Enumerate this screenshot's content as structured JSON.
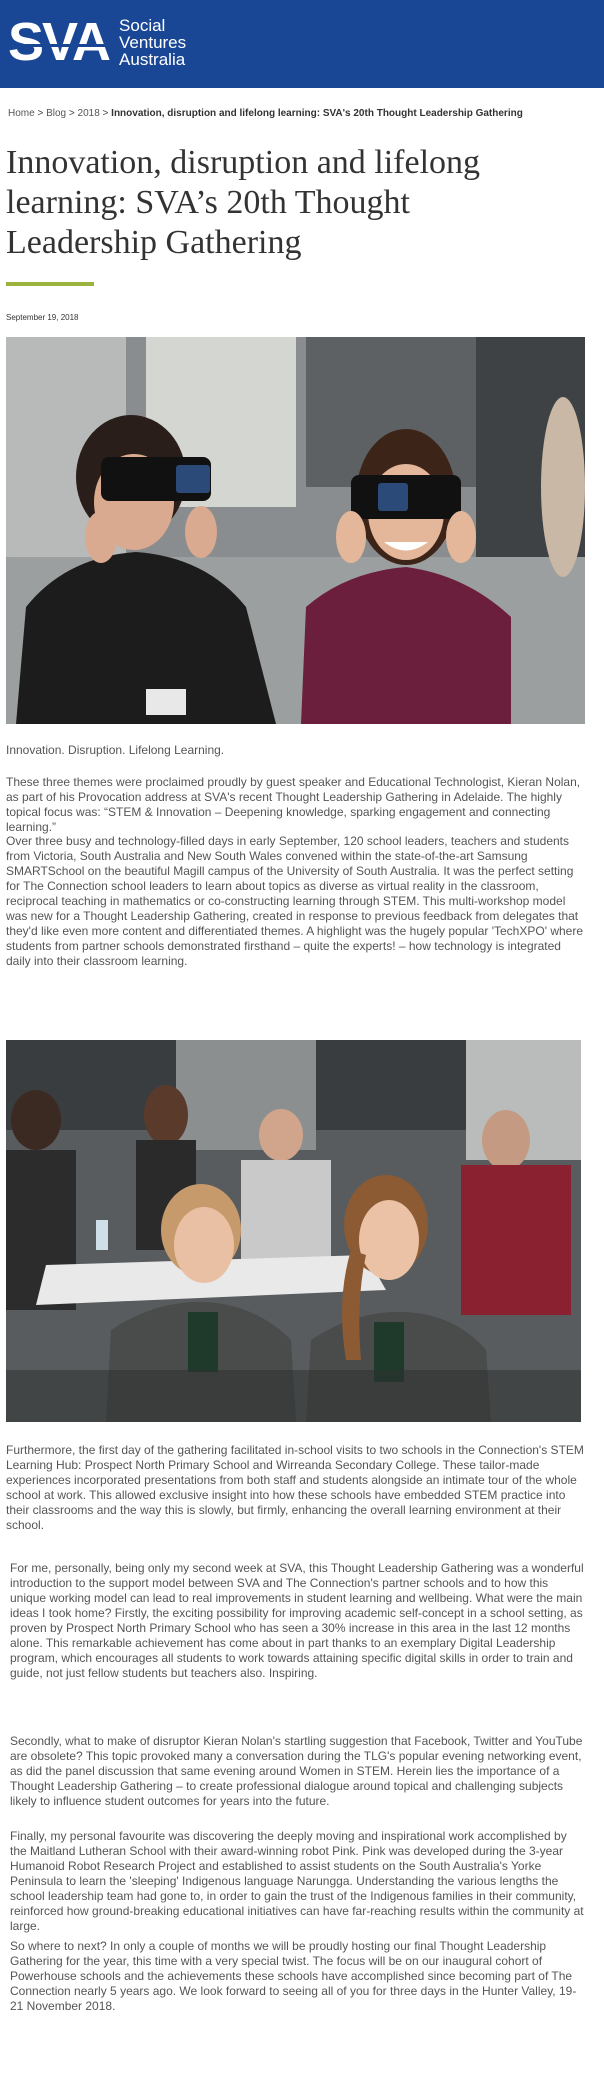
{
  "header": {
    "logo_mark": "SVA",
    "logo_lines": [
      "Social",
      "Ventures",
      "Australia"
    ],
    "background": "#1a4795"
  },
  "breadcrumb": {
    "items": [
      "Home",
      "Blog",
      "2018"
    ],
    "separator": ">",
    "current": "Innovation, disruption and lifelong learning: SVA's 20th Thought Leadership Gathering"
  },
  "article": {
    "title": "Innovation, disruption and lifelong learning: SVA’s 20th Thought Leadership Gathering",
    "accent_color": "#9cb43d",
    "date": "September 19, 2018",
    "intro": "Innovation. Disruption.  Lifelong Learning.",
    "paragraphs": [
      "These three themes were proclaimed proudly by guest speaker and Educational Technologist, Kieran Nolan, as part of his Provocation address at SVA's recent Thought Leadership Gathering in Adelaide. The highly topical focus was: “STEM & Innovation – Deepening knowledge, sparking engagement and connecting learning.”",
      "Over three busy and technology-filled days in early September, 120 school leaders, teachers and students from Victoria, South Australia and New South Wales convened within the state-of-the-art Samsung SMARTSchool on the beautiful Magill campus of the University of South Australia.  It was the perfect setting for  The Connection school leaders to learn about topics as diverse as virtual reality in the classroom, reciprocal teaching in mathematics or co-constructing learning through STEM.  This multi-workshop model was new for a Thought Leadership Gathering, created in response to previous feedback from delegates that they'd like even more content and differentiated themes. A highlight was the hugely popular 'TechXPO' where students from partner schools demonstrated firsthand – quite the experts! – how technology is integrated daily into their classroom learning.",
      "Furthermore, the first day of the gathering facilitated in-school visits to two schools in the Connection's STEM Learning Hub: Prospect North Primary School and Wirreanda Secondary College. These tailor-made experiences incorporated presentations from both staff and students alongside an intimate tour of the whole school at work. This allowed exclusive insight into how these schools have embedded STEM practice into their classrooms and the way this is slowly, but firmly, enhancing the overall learning environment at their school.",
      "For me, personally, being only my second week at SVA, this Thought Leadership Gathering was a wonderful introduction to the support model between SVA and The Connection's partner schools and to how this unique working model can lead to real improvements in student learning and wellbeing.  What were the main ideas I took home?  Firstly, the exciting possibility for improving academic self-concept in a school setting, as proven by Prospect North Primary School who has seen a 30% increase in this area in the last 12 months alone.  This remarkable achievement has come about in part thanks to an exemplary Digital Leadership program, which encourages all students to work towards attaining specific digital skills in order to train and guide, not just fellow students but teachers also.  Inspiring.",
      "Secondly, what to make of disruptor Kieran Nolan's startling suggestion that Facebook, Twitter and YouTube are obsolete? This topic provoked many a conversation during the TLG's popular evening networking event, as did the panel discussion that same evening around Women in STEM.  Herein lies the importance of a Thought Leadership Gathering – to create professional dialogue around topical and challenging subjects likely to influence student outcomes for years into the future.",
      "Finally, my personal favourite was discovering the deeply moving and inspirational work accomplished by the Maitland Lutheran School with their award-winning robot Pink. Pink was developed during the 3-year Humanoid Robot Research Project and established to assist students on the South Australia's Yorke Peninsula to learn the 'sleeping' Indigenous language Narungga.  Understanding the various lengths the school leadership team had gone to, in order to gain the trust of the Indigenous families in their community, reinforced how ground-breaking educational initiatives can have far-reaching results within the community at large.",
      "So where to next?  In only a couple of months we will be proudly hosting our final Thought Leadership Gathering for the year, this time with a very special twist.  The focus will be on our inaugural cohort of Powerhouse schools and the achievements these schools have accomplished since becoming part of The Connection nearly 5 years ago.  We look forward to seeing all of you for three days in the Hunter Valley, 19-21 November 2018."
    ]
  }
}
